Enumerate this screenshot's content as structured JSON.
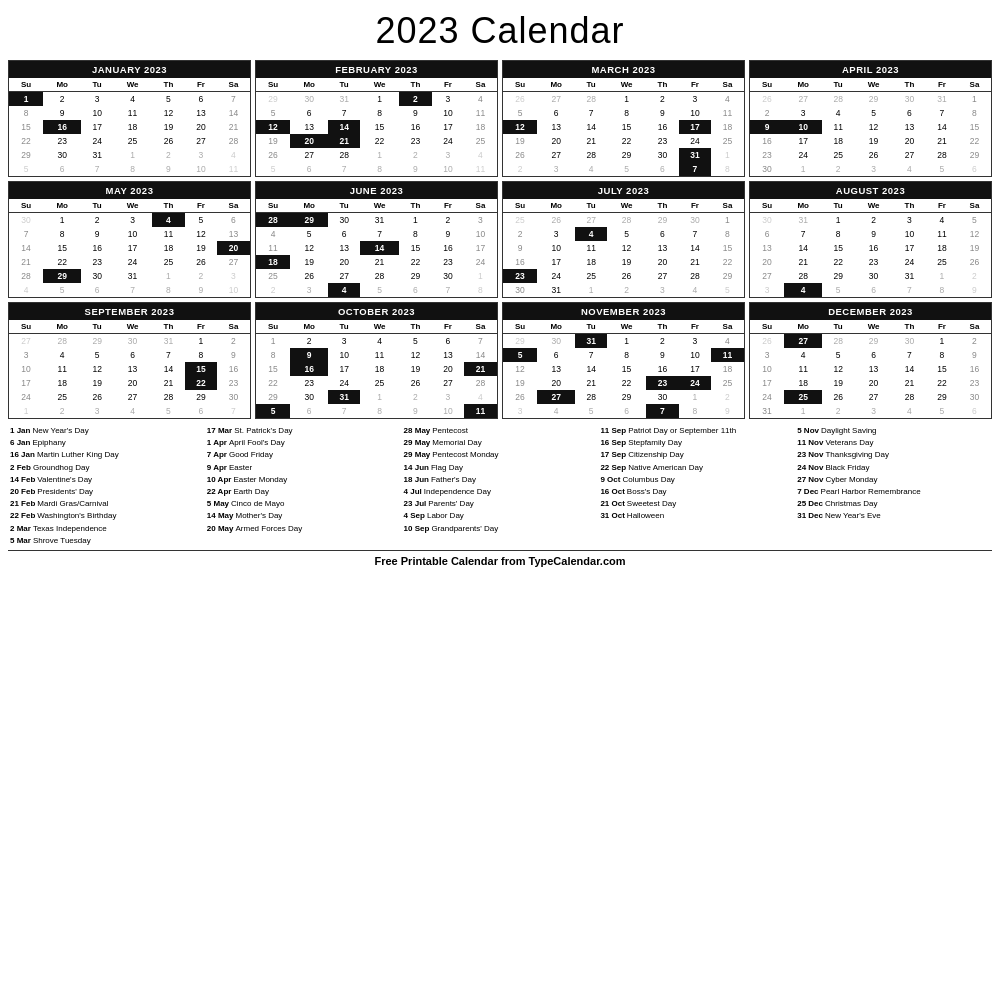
{
  "title": "2023 Calendar",
  "months": [
    {
      "name": "JANUARY 2023",
      "days_header": [
        "Su",
        "Mo",
        "Tu",
        "We",
        "Th",
        "Fr",
        "Sa"
      ],
      "weeks": [
        [
          "1h",
          "2",
          "3",
          "4",
          "5",
          "6",
          "7"
        ],
        [
          "8",
          "9",
          "10",
          "11",
          "12",
          "13",
          "14"
        ],
        [
          "15",
          "16h",
          "17",
          "18",
          "19",
          "20",
          "21"
        ],
        [
          "22",
          "23",
          "24",
          "25",
          "26",
          "27",
          "28"
        ],
        [
          "29",
          "30",
          "31",
          "1o",
          "2o",
          "3o",
          "4o"
        ],
        [
          "5o",
          "6o",
          "7o",
          "8o",
          "9o",
          "10o",
          "11o"
        ]
      ],
      "highlights": [
        "1",
        "16"
      ]
    },
    {
      "name": "FEBRUARY 2023",
      "days_header": [
        "Su",
        "Mo",
        "Tu",
        "We",
        "Th",
        "Fr",
        "Sa"
      ],
      "weeks": [
        [
          "29o",
          "30o",
          "31o",
          "1",
          "2h",
          "3",
          "4"
        ],
        [
          "5",
          "6",
          "7",
          "8",
          "9",
          "10",
          "11"
        ],
        [
          "12h",
          "13",
          "14h",
          "15",
          "16",
          "17",
          "18"
        ],
        [
          "19",
          "20h",
          "21h",
          "22",
          "23",
          "24",
          "25"
        ],
        [
          "26",
          "27",
          "28",
          "1o",
          "2o",
          "3o",
          "4o"
        ],
        [
          "5o",
          "6o",
          "7o",
          "8o",
          "9o",
          "10o",
          "11o"
        ]
      ],
      "highlights": [
        "2",
        "12",
        "14",
        "20",
        "21"
      ]
    },
    {
      "name": "MARCH 2023",
      "days_header": [
        "Su",
        "Mo",
        "Tu",
        "We",
        "Th",
        "Fr",
        "Sa"
      ],
      "weeks": [
        [
          "26o",
          "27o",
          "28o",
          "1",
          "2",
          "3",
          "4"
        ],
        [
          "5",
          "6",
          "7",
          "8",
          "9",
          "10",
          "11"
        ],
        [
          "12h",
          "13",
          "14",
          "15",
          "16",
          "17h",
          "18"
        ],
        [
          "19",
          "20",
          "21",
          "22",
          "23",
          "24",
          "25"
        ],
        [
          "26",
          "27",
          "28",
          "29",
          "30",
          "31h",
          "1o"
        ],
        [
          "2o",
          "3o",
          "4o",
          "5o",
          "6o",
          "7h",
          "8o"
        ]
      ],
      "highlights": [
        "12",
        "17",
        "31",
        "7"
      ]
    },
    {
      "name": "APRIL 2023",
      "days_header": [
        "Su",
        "Mo",
        "Tu",
        "We",
        "Th",
        "Fr",
        "Sa"
      ],
      "weeks": [
        [
          "26o",
          "27o",
          "28o",
          "29o",
          "30o",
          "31o",
          "1"
        ],
        [
          "2",
          "3",
          "4",
          "5",
          "6",
          "7",
          "8"
        ],
        [
          "9h",
          "10h",
          "11",
          "12",
          "13",
          "14",
          "15"
        ],
        [
          "16",
          "17",
          "18",
          "19",
          "20",
          "21",
          "22"
        ],
        [
          "23",
          "24",
          "25",
          "26",
          "27",
          "28",
          "29"
        ],
        [
          "30",
          "1o",
          "2o",
          "3o",
          "4o",
          "5o",
          "6o"
        ]
      ],
      "highlights": [
        "9",
        "10"
      ]
    },
    {
      "name": "MAY 2023",
      "days_header": [
        "Su",
        "Mo",
        "Tu",
        "We",
        "Th",
        "Fr",
        "Sa"
      ],
      "weeks": [
        [
          "30o",
          "1",
          "2",
          "3",
          "4h",
          "5",
          "6"
        ],
        [
          "7",
          "8",
          "9",
          "10",
          "11",
          "12",
          "13"
        ],
        [
          "14",
          "15",
          "16",
          "17",
          "18",
          "19",
          "20h"
        ],
        [
          "21",
          "22",
          "23",
          "24",
          "25",
          "26",
          "27"
        ],
        [
          "28",
          "29h",
          "30",
          "31",
          "1o",
          "2o",
          "3o"
        ],
        [
          "4o",
          "5o",
          "6o",
          "7o",
          "8o",
          "9o",
          "10o"
        ]
      ],
      "highlights": [
        "4",
        "20",
        "29"
      ]
    },
    {
      "name": "JUNE 2023",
      "days_header": [
        "Su",
        "Mo",
        "Tu",
        "We",
        "Th",
        "Fr",
        "Sa"
      ],
      "weeks": [
        [
          "28h",
          "29h",
          "30",
          "31",
          "1",
          "2",
          "3"
        ],
        [
          "4",
          "5",
          "6",
          "7",
          "8",
          "9",
          "10"
        ],
        [
          "11",
          "12",
          "13",
          "14h",
          "15",
          "16",
          "17"
        ],
        [
          "18h",
          "19",
          "20",
          "21",
          "22",
          "23",
          "24"
        ],
        [
          "25",
          "26",
          "27",
          "28",
          "29",
          "30",
          "1o"
        ],
        [
          "2o",
          "3o",
          "4h",
          "5o",
          "6o",
          "7o",
          "8o"
        ]
      ],
      "highlights": [
        "28",
        "29",
        "14",
        "18",
        "4"
      ]
    },
    {
      "name": "JULY 2023",
      "days_header": [
        "Su",
        "Mo",
        "Tu",
        "We",
        "Th",
        "Fr",
        "Sa"
      ],
      "weeks": [
        [
          "25o",
          "26o",
          "27o",
          "28o",
          "29o",
          "30o",
          "1"
        ],
        [
          "2",
          "3",
          "4h",
          "5",
          "6",
          "7",
          "8"
        ],
        [
          "9",
          "10",
          "11",
          "12",
          "13",
          "14",
          "15"
        ],
        [
          "16",
          "17",
          "18",
          "19",
          "20",
          "21",
          "22"
        ],
        [
          "23h",
          "24",
          "25",
          "26",
          "27",
          "28",
          "29"
        ],
        [
          "30",
          "31",
          "1o",
          "2o",
          "3o",
          "4o",
          "5o"
        ]
      ],
      "highlights": [
        "4",
        "23"
      ]
    },
    {
      "name": "AUGUST 2023",
      "days_header": [
        "Su",
        "Mo",
        "Tu",
        "We",
        "Th",
        "Fr",
        "Sa"
      ],
      "weeks": [
        [
          "30o",
          "31o",
          "1",
          "2",
          "3",
          "4",
          "5"
        ],
        [
          "6",
          "7",
          "8",
          "9",
          "10",
          "11",
          "12"
        ],
        [
          "13",
          "14",
          "15",
          "16",
          "17",
          "18",
          "19"
        ],
        [
          "20",
          "21",
          "22",
          "23",
          "24",
          "25",
          "26"
        ],
        [
          "27",
          "28",
          "29",
          "30",
          "31",
          "1o",
          "2o"
        ],
        [
          "3o",
          "4h",
          "5o",
          "6o",
          "7o",
          "8o",
          "9o"
        ]
      ],
      "highlights": [
        "4"
      ]
    },
    {
      "name": "SEPTEMBER 2023",
      "days_header": [
        "Su",
        "Mo",
        "Tu",
        "We",
        "Th",
        "Fr",
        "Sa"
      ],
      "weeks": [
        [
          "27o",
          "28o",
          "29o",
          "30o",
          "31o",
          "1",
          "2"
        ],
        [
          "3",
          "4",
          "5",
          "6",
          "7",
          "8",
          "9"
        ],
        [
          "10",
          "11",
          "12",
          "13",
          "14",
          "15h",
          "16"
        ],
        [
          "17",
          "18",
          "19",
          "20",
          "21",
          "22h",
          "23"
        ],
        [
          "24",
          "25",
          "26",
          "27",
          "28",
          "29",
          "30"
        ],
        [
          "1o",
          "2o",
          "3o",
          "4o",
          "5o",
          "6o",
          "7o"
        ]
      ],
      "highlights": [
        "15",
        "22"
      ]
    },
    {
      "name": "OCTOBER 2023",
      "days_header": [
        "Su",
        "Mo",
        "Tu",
        "We",
        "Th",
        "Fr",
        "Sa"
      ],
      "weeks": [
        [
          "1",
          "2",
          "3",
          "4",
          "5",
          "6",
          "7"
        ],
        [
          "8",
          "9h",
          "10",
          "11",
          "12",
          "13",
          "14"
        ],
        [
          "15",
          "16h",
          "17",
          "18",
          "19",
          "20",
          "21h"
        ],
        [
          "22",
          "23",
          "24",
          "25",
          "26",
          "27",
          "28"
        ],
        [
          "29",
          "30",
          "31h",
          "1o",
          "2o",
          "3o",
          "4o"
        ],
        [
          "5h",
          "6o",
          "7o",
          "8o",
          "9o",
          "10o",
          "11h"
        ]
      ],
      "highlights": [
        "9",
        "16",
        "21",
        "31",
        "5",
        "11"
      ]
    },
    {
      "name": "NOVEMBER 2023",
      "days_header": [
        "Su",
        "Mo",
        "Tu",
        "We",
        "Th",
        "Fr",
        "Sa"
      ],
      "weeks": [
        [
          "29o",
          "30o",
          "31h",
          "1",
          "2",
          "3",
          "4"
        ],
        [
          "5h",
          "6",
          "7",
          "8",
          "9",
          "10",
          "11h"
        ],
        [
          "12",
          "13",
          "14",
          "15",
          "16",
          "17",
          "18"
        ],
        [
          "19",
          "20",
          "21",
          "22",
          "23h",
          "24h",
          "25"
        ],
        [
          "26",
          "27h",
          "28",
          "29",
          "30",
          "1o",
          "2o"
        ],
        [
          "3o",
          "4o",
          "5o",
          "6o",
          "7h",
          "8o",
          "9o"
        ]
      ],
      "highlights": [
        "31",
        "5",
        "11",
        "23",
        "24",
        "27",
        "7"
      ]
    },
    {
      "name": "DECEMBER 2023",
      "days_header": [
        "Su",
        "Mo",
        "Tu",
        "We",
        "Th",
        "Fr",
        "Sa"
      ],
      "weeks": [
        [
          "26o",
          "27h",
          "28o",
          "29o",
          "30o",
          "1",
          "2"
        ],
        [
          "3",
          "4",
          "5",
          "6",
          "7",
          "8",
          "9"
        ],
        [
          "10",
          "11",
          "12",
          "13",
          "14",
          "15",
          "16"
        ],
        [
          "17",
          "18",
          "19",
          "20",
          "21",
          "22",
          "23"
        ],
        [
          "24",
          "25h",
          "26",
          "27",
          "28",
          "29",
          "30"
        ],
        [
          "31",
          "1o",
          "2o",
          "3o",
          "4o",
          "5o",
          "6o"
        ]
      ],
      "highlights": [
        "27",
        "25"
      ]
    }
  ],
  "holidays": [
    {
      "col": [
        {
          "date": "1 Jan",
          "name": "New Year's Day"
        },
        {
          "date": "6 Jan",
          "name": "Epiphany"
        },
        {
          "date": "16 Jan",
          "name": "Martin Luther King Day"
        },
        {
          "date": "2 Feb",
          "name": "Groundhog Day"
        },
        {
          "date": "14 Feb",
          "name": "Valentine's Day"
        },
        {
          "date": "20 Feb",
          "name": "Presidents' Day"
        },
        {
          "date": "21 Feb",
          "name": "Mardi Gras/Carnival"
        },
        {
          "date": "22 Feb",
          "name": "Washington's Birthday"
        },
        {
          "date": "2 Mar",
          "name": "Texas Independence"
        },
        {
          "date": "5 Mar",
          "name": "Shrove Tuesday"
        }
      ]
    },
    {
      "col": [
        {
          "date": "17 Mar",
          "name": "St. Patrick's Day"
        },
        {
          "date": "1 Apr",
          "name": "April Fool's Day"
        },
        {
          "date": "7 Apr",
          "name": "Good Friday"
        },
        {
          "date": "9 Apr",
          "name": "Easter"
        },
        {
          "date": "10 Apr",
          "name": "Easter Monday"
        },
        {
          "date": "22 Apr",
          "name": "Earth Day"
        },
        {
          "date": "5 May",
          "name": "Cinco de Mayo"
        },
        {
          "date": "14 May",
          "name": "Mother's Day"
        },
        {
          "date": "20 May",
          "name": "Armed Forces Day"
        }
      ]
    },
    {
      "col": [
        {
          "date": "28 May",
          "name": "Pentecost"
        },
        {
          "date": "29 May",
          "name": "Memorial Day"
        },
        {
          "date": "29 May",
          "name": "Pentecost Monday"
        },
        {
          "date": "14 Jun",
          "name": "Flag Day"
        },
        {
          "date": "18 Jun",
          "name": "Father's Day"
        },
        {
          "date": "4 Jul",
          "name": "Independence Day"
        },
        {
          "date": "23 Jul",
          "name": "Parents' Day"
        },
        {
          "date": "4 Sep",
          "name": "Labor Day"
        },
        {
          "date": "10 Sep",
          "name": "Grandparents' Day"
        }
      ]
    },
    {
      "col": [
        {
          "date": "11 Sep",
          "name": "Patriot Day or September 11th"
        },
        {
          "date": "16 Sep",
          "name": "Stepfamily Day"
        },
        {
          "date": "17 Sep",
          "name": "Citizenship Day"
        },
        {
          "date": "22 Sep",
          "name": "Native American Day"
        },
        {
          "date": "9 Oct",
          "name": "Columbus Day"
        },
        {
          "date": "16 Oct",
          "name": "Boss's Day"
        },
        {
          "date": "21 Oct",
          "name": "Sweetest Day"
        },
        {
          "date": "31 Oct",
          "name": "Halloween"
        }
      ]
    },
    {
      "col": [
        {
          "date": "5 Nov",
          "name": "Daylight Saving"
        },
        {
          "date": "11 Nov",
          "name": "Veterans Day"
        },
        {
          "date": "23 Nov",
          "name": "Thanksgiving Day"
        },
        {
          "date": "24 Nov",
          "name": "Black Friday"
        },
        {
          "date": "27 Nov",
          "name": "Cyber Monday"
        },
        {
          "date": "7 Dec",
          "name": "Pearl Harbor Remembrance"
        },
        {
          "date": "25 Dec",
          "name": "Christmas Day"
        },
        {
          "date": "31 Dec",
          "name": "New Year's Eve"
        }
      ]
    }
  ],
  "footer": "Free Printable Calendar from TypeCalendar.com"
}
